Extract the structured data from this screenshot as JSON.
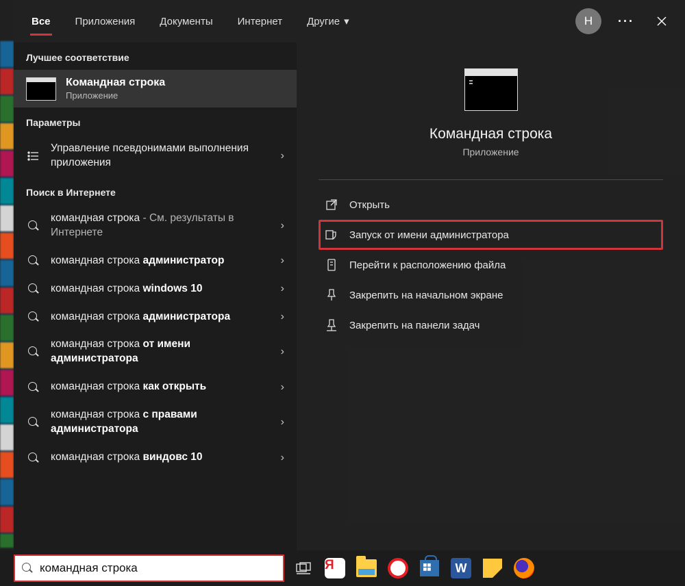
{
  "tabs": {
    "items": [
      "Все",
      "Приложения",
      "Документы",
      "Интернет",
      "Другие"
    ],
    "active_index": 0
  },
  "avatar_initial": "Н",
  "left": {
    "best_header": "Лучшее соответствие",
    "best_match": {
      "title": "Командная строка",
      "subtitle": "Приложение"
    },
    "settings_header": "Параметры",
    "settings_item": "Управление псевдонимами выполнения приложения",
    "web_header": "Поиск в Интернете",
    "web_items": [
      {
        "plain": "командная строка",
        "muted": " - См. результаты в Интернете",
        "bold": ""
      },
      {
        "plain": "командная строка ",
        "muted": "",
        "bold": "администратор"
      },
      {
        "plain": "командная строка ",
        "muted": "",
        "bold": "windows 10"
      },
      {
        "plain": "командная строка ",
        "muted": "",
        "bold": "администратора"
      },
      {
        "plain": "командная строка ",
        "muted": "",
        "bold": "от имени администратора"
      },
      {
        "plain": "командная строка ",
        "muted": "",
        "bold": "как открыть"
      },
      {
        "plain": "командная строка ",
        "muted": "",
        "bold": "с правами администратора"
      },
      {
        "plain": "командная строка ",
        "muted": "",
        "bold": "виндовс 10"
      }
    ]
  },
  "right": {
    "title": "Командная строка",
    "subtitle": "Приложение",
    "actions": [
      {
        "icon": "open",
        "label": "Открыть"
      },
      {
        "icon": "shield",
        "label": "Запуск от имени администратора",
        "highlight": true
      },
      {
        "icon": "location",
        "label": "Перейти к расположению файла"
      },
      {
        "icon": "pin-start",
        "label": "Закрепить на начальном экране"
      },
      {
        "icon": "pin-task",
        "label": "Закрепить на панели задач"
      }
    ]
  },
  "search_value": "командная строка"
}
